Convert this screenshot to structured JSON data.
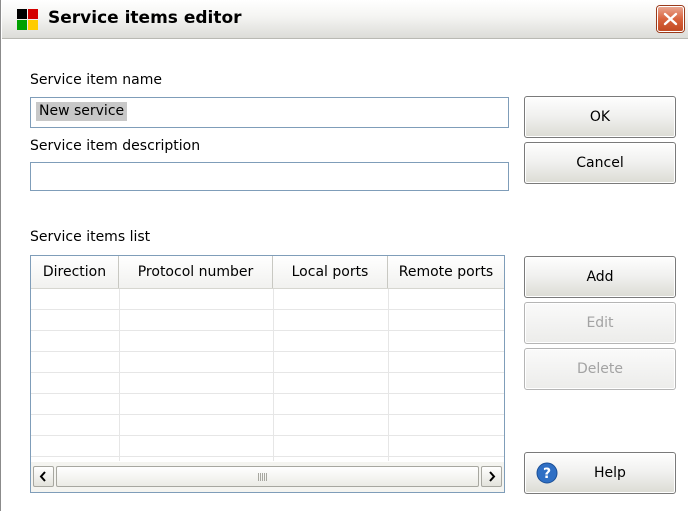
{
  "window": {
    "title": "Service items editor",
    "icon": "avast-logo-icon",
    "accent_colors": [
      "#000000",
      "#d40000",
      "#00a000",
      "#ffcc00"
    ]
  },
  "form": {
    "name_label": "Service item name",
    "name_value": "New service",
    "description_label": "Service item description",
    "description_value": "",
    "list_label": "Service items list"
  },
  "list": {
    "columns": [
      "Direction",
      "Protocol number",
      "Local ports",
      "Remote ports"
    ],
    "rows": []
  },
  "buttons": {
    "ok": "OK",
    "cancel": "Cancel",
    "add": "Add",
    "edit": "Edit",
    "delete": "Delete",
    "help": "Help"
  }
}
